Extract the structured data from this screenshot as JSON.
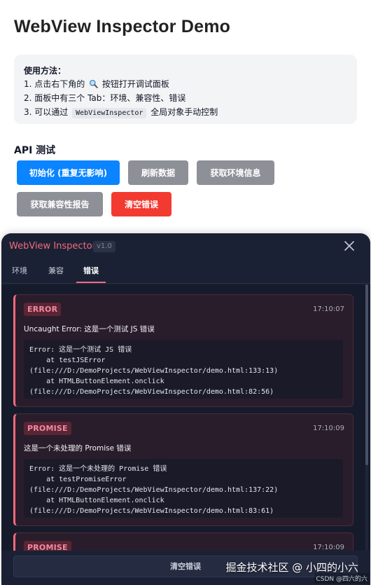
{
  "page": {
    "title": "WebView Inspector Demo"
  },
  "instructions": {
    "heading": "使用方法：",
    "line1_prefix": "1. 点击右下角的",
    "line1_icon": "magnifier-icon",
    "line1_suffix": "按钮打开调试面板",
    "line2": "2. 面板中有三个 Tab：环境、兼容性、错误",
    "line3_prefix": "3. 可以通过",
    "line3_code": "WebViewInspector",
    "line3_suffix": "全局对象手动控制"
  },
  "api": {
    "title": "API 测试",
    "buttons": [
      {
        "label": "初始化 (重复无影响)",
        "variant": "primary"
      },
      {
        "label": "刷新数据",
        "variant": "secondary"
      },
      {
        "label": "获取环境信息",
        "variant": "secondary"
      },
      {
        "label": "获取兼容性报告",
        "variant": "secondary"
      },
      {
        "label": "清空错误",
        "variant": "danger"
      }
    ]
  },
  "inspector": {
    "title": "WebView Inspector",
    "version": "v1.0",
    "close_icon": "close-icon",
    "tabs": [
      {
        "label": "环境",
        "active": false
      },
      {
        "label": "兼容",
        "active": false
      },
      {
        "label": "错误",
        "active": true
      }
    ],
    "errors": [
      {
        "type": "ERROR",
        "time": "17:10:07",
        "message": "Uncaught Error: 这是一个测试 JS 错误",
        "stack": [
          "Error: 这是一个测试 JS 错误",
          "    at testJSError",
          "(file:///D:/DemoProjects/WebViewInspector/demo.html:133:13)",
          "    at HTMLButtonElement.onclick",
          "(file:///D:/DemoProjects/WebViewInspector/demo.html:82:56)"
        ]
      },
      {
        "type": "PROMISE",
        "time": "17:10:09",
        "message": "这是一个未处理的 Promise 错误",
        "stack": [
          "Error: 这是一个未处理的 Promise 错误",
          "    at testPromiseError",
          "(file:///D:/DemoProjects/WebViewInspector/demo.html:137:22)",
          "    at HTMLButtonElement.onclick",
          "(file:///D:/DemoProjects/WebViewInspector/demo.html:83:61)"
        ]
      },
      {
        "type": "PROMISE",
        "time": "17:10:09"
      }
    ],
    "footer_button": "清空错误"
  },
  "watermark": {
    "text": "掘金技术社区 @ 小四的小六",
    "sub": "CSDN @四六的六"
  },
  "colors": {
    "accent_pink": "#f26b7c",
    "primary_blue": "#0a84ff",
    "danger_red": "#f23a31",
    "secondary_gray": "#8e9097",
    "panel_bg": "#1b2135"
  }
}
